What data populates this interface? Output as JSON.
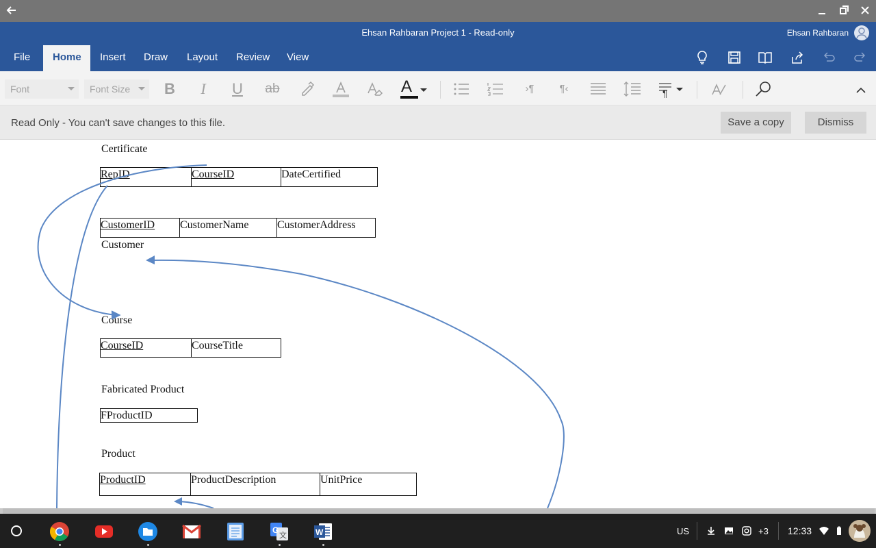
{
  "window": {
    "back_icon": "arrow-left-icon",
    "minimize_icon": "minimize-icon",
    "restore_icon": "restore-icon",
    "close_icon": "close-icon"
  },
  "title_bar": {
    "title": "Ehsan Rahbaran Project 1  - Read-only",
    "user_name": "Ehsan Rahbaran",
    "user_icon": "person-icon",
    "color": "#2b579a"
  },
  "menu": {
    "tabs": [
      {
        "label": "File"
      },
      {
        "label": "Home"
      },
      {
        "label": "Insert"
      },
      {
        "label": "Draw"
      },
      {
        "label": "Layout"
      },
      {
        "label": "Review"
      },
      {
        "label": "View"
      }
    ],
    "active_tab": "Home",
    "right_icons": [
      "lightbulb-icon",
      "save-icon",
      "reading-view-icon",
      "share-icon",
      "undo-icon",
      "redo-icon"
    ]
  },
  "ribbon": {
    "font_placeholder": "Font",
    "font_size_placeholder": "Font Size",
    "bold": "B",
    "italic": "I",
    "underline": "U",
    "strikethrough": "ab",
    "font_color_letter": "A",
    "tools": [
      "highlighter-icon",
      "font-color-icon",
      "clear-format-icon",
      "bullets-icon",
      "numbering-icon",
      "ltr-paragraph-icon",
      "rtl-paragraph-icon",
      "align-icon",
      "line-spacing-icon",
      "paragraph-styles-icon",
      "styles-icon",
      "find-icon",
      "collapse-ribbon-icon"
    ]
  },
  "notice": {
    "message": "Read Only - You can't save changes to this file.",
    "save_copy": "Save a copy",
    "dismiss": "Dismiss"
  },
  "document": {
    "certificate": {
      "title": "Certificate",
      "columns": [
        "RepID",
        "CourseID",
        "DateCertified"
      ]
    },
    "customer": {
      "title": "Customer",
      "columns": [
        "CustomerID",
        "CustomerName",
        "CustomerAddress"
      ]
    },
    "course": {
      "title": "Course",
      "columns": [
        "CourseID",
        "CourseTitle"
      ]
    },
    "fabricated_product": {
      "title": "Fabricated Product",
      "columns": [
        "FProductID"
      ]
    },
    "product": {
      "title": "Product",
      "columns": [
        "ProductID",
        "ProductDescription",
        "UnitPrice"
      ]
    },
    "arrow_color": "#5b87c5"
  },
  "shelf": {
    "apps": [
      "chrome-icon",
      "youtube-icon",
      "files-icon",
      "gmail-icon",
      "keep-icon",
      "translate-icon",
      "word-icon"
    ],
    "locale": "US",
    "notifications_more": "+3",
    "time": "12:33",
    "tray_icons": [
      "download-icon",
      "image-icon",
      "instagram-icon",
      "wifi-icon",
      "battery-icon"
    ]
  }
}
